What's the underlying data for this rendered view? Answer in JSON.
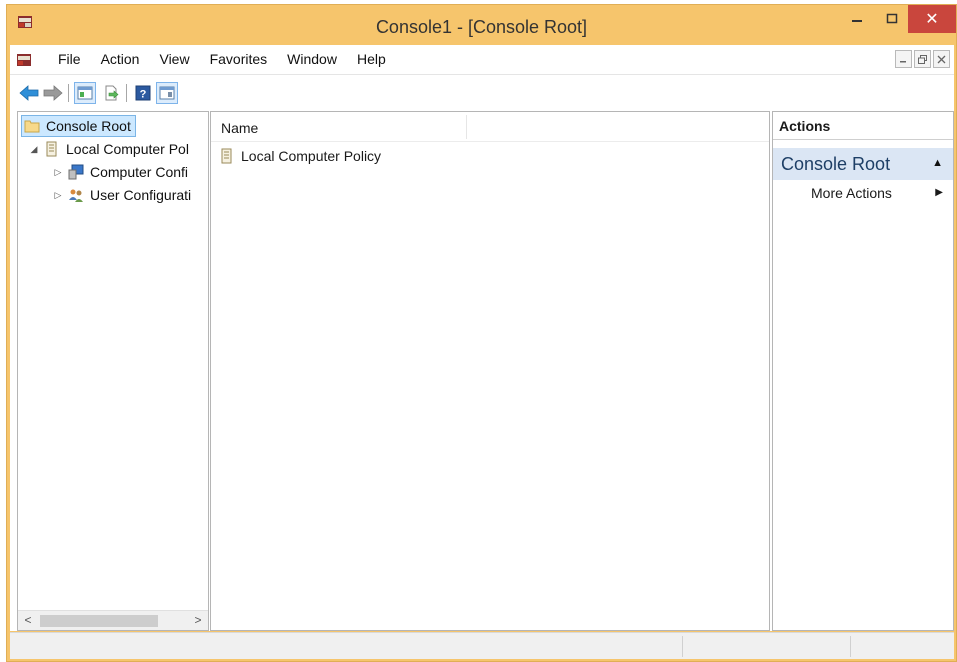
{
  "window": {
    "title": "Console1 - [Console Root]",
    "close_symbol": "✕",
    "accent_color": "#f6c56c",
    "close_color": "#c9463d"
  },
  "menu": {
    "items": [
      "File",
      "Action",
      "View",
      "Favorites",
      "Window",
      "Help"
    ]
  },
  "toolbar": {
    "buttons": [
      "back-icon",
      "forward-icon",
      "show-hide-console-tree-icon",
      "export-list-icon",
      "help-icon",
      "show-hide-action-pane-icon"
    ]
  },
  "tree": {
    "root": "Console Root",
    "policy": "Local Computer Pol",
    "computer_config": "Computer Confi",
    "user_config": "User Configurati"
  },
  "list": {
    "column_name": "Name",
    "items": [
      "Local Computer Policy"
    ]
  },
  "actions": {
    "header": "Actions",
    "group_title": "Console Root",
    "more_actions": "More Actions"
  }
}
